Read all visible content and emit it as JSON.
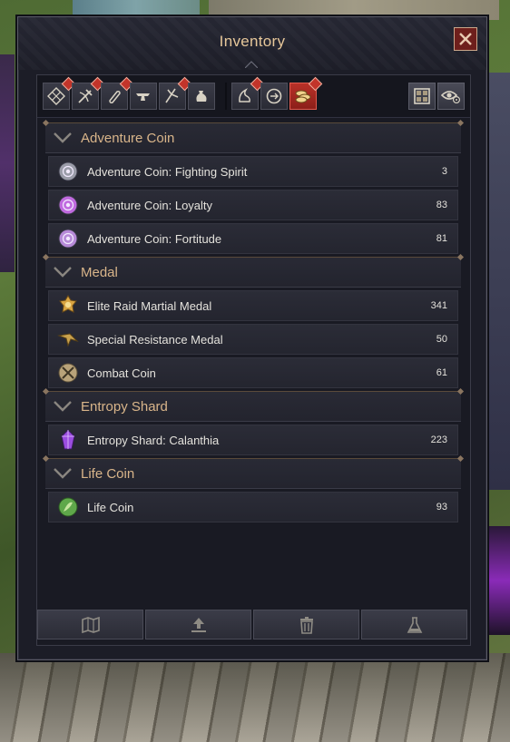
{
  "window": {
    "title": "Inventory"
  },
  "tabs": [
    {
      "icon": "all-items-icon",
      "has_notice": true,
      "active": false
    },
    {
      "icon": "equipment-icon",
      "has_notice": true,
      "active": false
    },
    {
      "icon": "consumable-icon",
      "has_notice": true,
      "active": false
    },
    {
      "icon": "anvil-icon",
      "has_notice": false,
      "active": false
    },
    {
      "icon": "crafting-material-icon",
      "has_notice": true,
      "active": false
    },
    {
      "icon": "pouch-icon",
      "has_notice": false,
      "active": false
    },
    {
      "icon": "quest-item-icon",
      "has_notice": true,
      "active": false
    },
    {
      "icon": "currency-exchange-icon",
      "has_notice": false,
      "active": false
    },
    {
      "icon": "coins-icon",
      "has_notice": true,
      "active": true
    }
  ],
  "tools": [
    {
      "icon": "grid-view-icon"
    },
    {
      "icon": "eye-settings-icon"
    }
  ],
  "groups": [
    {
      "title": "Adventure Coin",
      "items": [
        {
          "name": "Adventure Coin: Fighting Spirit",
          "qty": "3",
          "icon": "silver-coin-icon",
          "color": "#9a9ca8"
        },
        {
          "name": "Adventure Coin: Loyalty",
          "qty": "83",
          "icon": "purple-coin-icon",
          "color": "#c06adf"
        },
        {
          "name": "Adventure Coin: Fortitude",
          "qty": "81",
          "icon": "violet-coin-icon",
          "color": "#b78ad8"
        }
      ]
    },
    {
      "title": "Medal",
      "items": [
        {
          "name": "Elite Raid Martial Medal",
          "qty": "341",
          "icon": "gold-medal-icon",
          "color": "#d9a441"
        },
        {
          "name": "Special Resistance Medal",
          "qty": "50",
          "icon": "winged-medal-icon",
          "color": "#c9a24e"
        },
        {
          "name": "Combat Coin",
          "qty": "61",
          "icon": "crossed-swords-coin-icon",
          "color": "#b9a37a"
        }
      ]
    },
    {
      "title": "Entropy Shard",
      "items": [
        {
          "name": "Entropy Shard: Calanthia",
          "qty": "223",
          "icon": "purple-crystal-icon",
          "color": "#9b4de0"
        }
      ]
    },
    {
      "title": "Life Coin",
      "items": [
        {
          "name": "Life Coin",
          "qty": "93",
          "icon": "green-coin-icon",
          "color": "#5fa84a"
        }
      ]
    }
  ],
  "bottom_actions": [
    {
      "icon": "map-icon"
    },
    {
      "icon": "upload-icon"
    },
    {
      "icon": "trash-icon"
    },
    {
      "icon": "flask-icon"
    }
  ],
  "colors": {
    "accent_gold": "#d9b58a",
    "active_tab_red": "#b93128",
    "notice_red": "#c2342a"
  }
}
